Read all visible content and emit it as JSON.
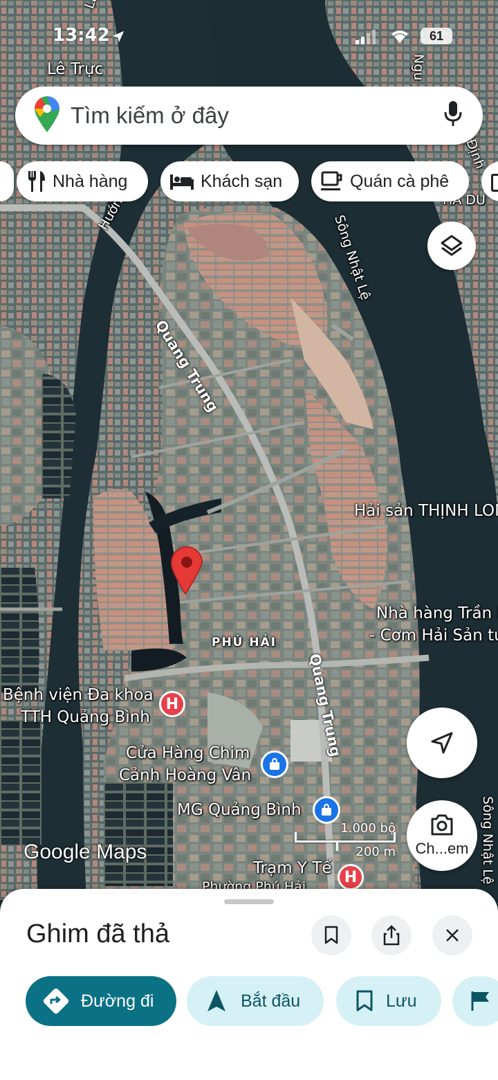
{
  "status_bar": {
    "time": "13:42",
    "battery": "61"
  },
  "search": {
    "placeholder": "Tìm kiếm ở đây"
  },
  "chips": [
    {
      "label": "Nhà hàng",
      "icon": "fork-knife-icon"
    },
    {
      "label": "Khách sạn",
      "icon": "bed-icon"
    },
    {
      "label": "Quán cà phê",
      "icon": "coffee-cup-icon"
    }
  ],
  "map_labels": {
    "le_truc": "Lê Trực",
    "lam": "Lâm",
    "huong": "Hướng",
    "nguyen": "Ngu",
    "dinh": "Định",
    "ha_du": "HẢ DU",
    "song_nhat_le": "Sông Nhật Lệ",
    "song_nhat_le_2": "Sông Nhật Lệ",
    "quang_trung_1": "Quang Trung",
    "quang_trung_2": "Quang Trung",
    "phu_hai": "PHÚ HẢI",
    "hai_san": "Hải sản THỊNH LON",
    "nha_hang_1": "Nhà hàng Trần H",
    "nha_hang_2": "- Cơm Hải Sản tư",
    "benh_vien_1": "Bệnh viện Đa khoa",
    "benh_vien_2": "TTH Quảng Bình",
    "cua_hang_1": "Cửa Hàng Chim",
    "cua_hang_2": "Cảnh Hoàng Vân",
    "mg": "MG Quảng Bình",
    "tram_1": "Trạm Y Tế",
    "tram_2": "Phường Phú Hải"
  },
  "scale": {
    "imperial": "1.000 bộ",
    "metric": "200 m"
  },
  "watermark": "Google Maps",
  "lens_label": "Ch...em",
  "sheet": {
    "title": "Ghim đã thả",
    "actions": [
      {
        "label": "Đường đi"
      },
      {
        "label": "Bắt đầu"
      },
      {
        "label": "Lưu"
      }
    ]
  },
  "colors": {
    "accent": "#0b7285",
    "accent_light": "#d6f1f5",
    "pin": "#e53935"
  }
}
